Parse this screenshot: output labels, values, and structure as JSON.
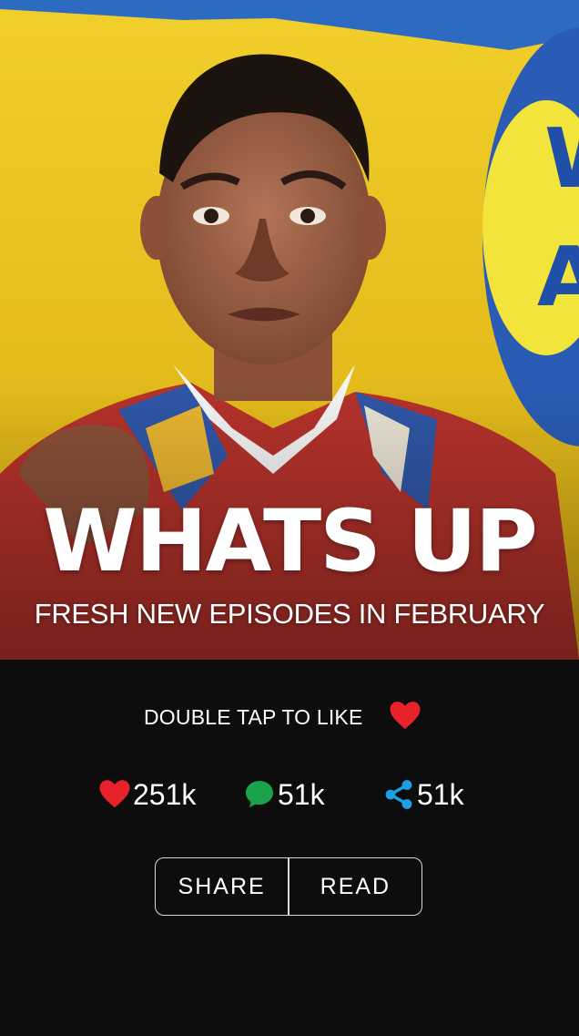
{
  "hero": {
    "title": "WHATS UP",
    "subtitle": "FRESH NEW EPISODES IN FEBRUARY",
    "logo_partial": "W A"
  },
  "like_prompt": {
    "label": "DOUBLE TAP TO LIKE",
    "icon": "heart-icon",
    "color": "#e8222b"
  },
  "stats": [
    {
      "icon": "heart-icon",
      "value": "251k",
      "color": "#e8222b"
    },
    {
      "icon": "comment-icon",
      "value": "51k",
      "color": "#1aa34a"
    },
    {
      "icon": "share-icon",
      "value": "51k",
      "color": "#1f9ee0"
    }
  ],
  "actions": {
    "share_label": "SHARE",
    "read_label": "READ"
  },
  "colors": {
    "background": "#0d0d0d",
    "hero_yellow": "#e7c21c",
    "border": "#d9d9d9"
  }
}
